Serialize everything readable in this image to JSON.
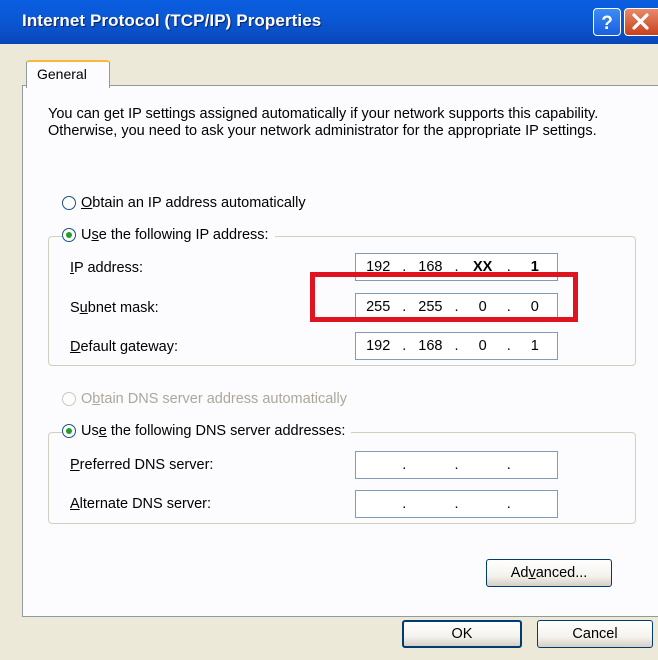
{
  "window": {
    "title": "Internet Protocol (TCP/IP) Properties"
  },
  "tabs": [
    {
      "label": "General"
    }
  ],
  "description": "You can get IP settings assigned automatically if your network supports this capability. Otherwise, you need to ask your network administrator for the appropriate IP settings.",
  "ip_section": {
    "obtain_auto": {
      "prefix": "",
      "ul": "O",
      "rest": "btain an IP address automatically",
      "selected": false
    },
    "use_following": {
      "prefix": "U",
      "ul": "s",
      "rest": "e the following IP address:",
      "selected": true
    },
    "fields": {
      "ip_address": {
        "prefix": "",
        "ul": "I",
        "rest": "P address:",
        "octets": [
          "192",
          "168",
          "XX",
          "1"
        ]
      },
      "subnet_mask": {
        "prefix": "S",
        "ul": "u",
        "rest": "bnet mask:",
        "octets": [
          "255",
          "255",
          "0",
          "0"
        ]
      },
      "default_gateway": {
        "prefix": "",
        "ul": "D",
        "rest": "efault gateway:",
        "octets": [
          "192",
          "168",
          "0",
          "1"
        ]
      }
    }
  },
  "dns_section": {
    "obtain_auto": {
      "prefix": "O",
      "ul": "b",
      "rest": "tain DNS server address automatically",
      "selected": false,
      "enabled": false
    },
    "use_following": {
      "prefix": "Us",
      "ul": "e",
      "rest": " the following DNS server addresses:",
      "selected": true
    },
    "fields": {
      "preferred": {
        "prefix": "",
        "ul": "P",
        "rest": "referred DNS server:",
        "octets": [
          "",
          "",
          "",
          ""
        ]
      },
      "alternate": {
        "prefix": "",
        "ul": "A",
        "rest": "lternate DNS server:",
        "octets": [
          "",
          "",
          "",
          ""
        ]
      }
    }
  },
  "buttons": {
    "advanced": {
      "prefix": "Ad",
      "ul": "v",
      "rest": "anced..."
    },
    "ok": "OK",
    "cancel": "Cancel"
  },
  "colors": {
    "titlebar": "#0a58d6",
    "highlight_box": "#e0141e",
    "dialog_bg": "#ece9d8"
  },
  "icons": [
    "help-icon",
    "close-icon"
  ]
}
